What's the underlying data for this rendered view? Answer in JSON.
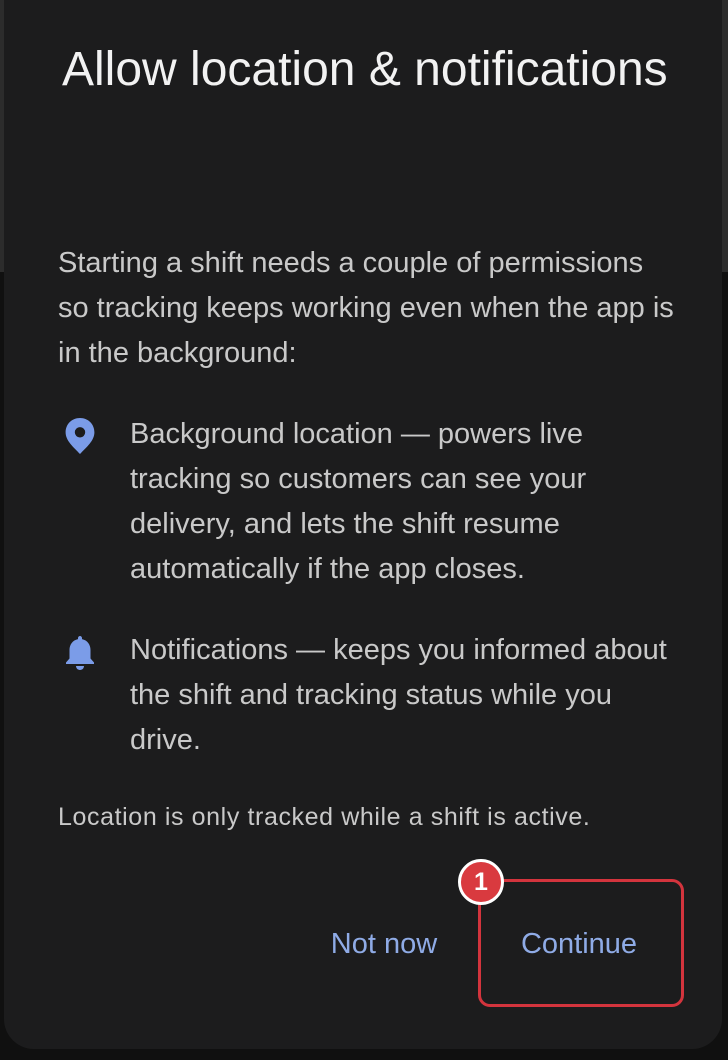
{
  "dialog": {
    "title": "Allow location & notifications",
    "intro": "Starting a shift needs a couple of permissions so tracking keeps working even when the app is in the background:",
    "permissions": [
      {
        "icon": "location-pin-icon",
        "text": "Background location — powers live tracking so customers can see your delivery, and lets the shift resume automatically if the app closes."
      },
      {
        "icon": "bell-icon",
        "text": "Notifications — keeps you informed about the shift and tracking status while you drive."
      }
    ],
    "note": "Location is only tracked while a shift is active.",
    "buttons": {
      "not_now": "Not now",
      "continue": "Continue"
    }
  },
  "annotation": {
    "step_number": "1"
  },
  "colors": {
    "dialog_background": "#1c1c1d",
    "accent": "#8fabe6",
    "icon": "#7b9ce8",
    "highlight": "#d3343d"
  }
}
